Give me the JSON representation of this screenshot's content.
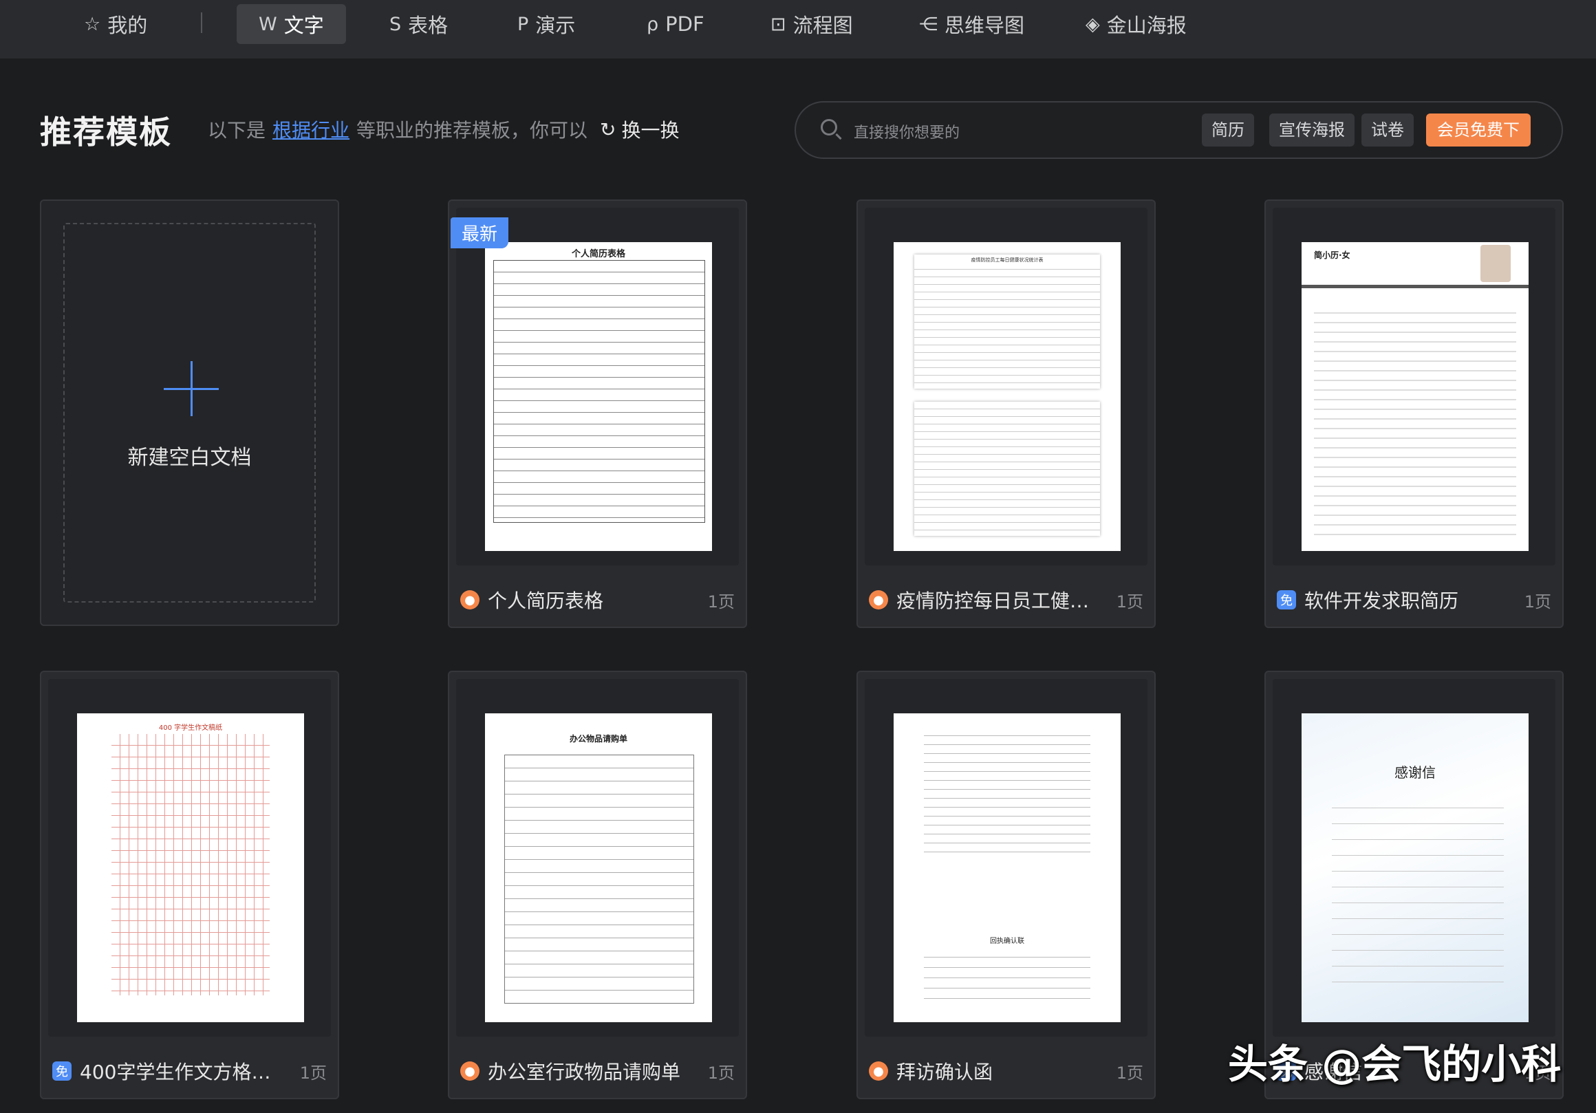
{
  "nav": {
    "tabs": [
      {
        "label": "我的",
        "icon": "star-icon"
      },
      {
        "label": "文字",
        "icon": "word-icon"
      },
      {
        "label": "表格",
        "icon": "sheet-icon"
      },
      {
        "label": "演示",
        "icon": "slides-icon"
      },
      {
        "label": "PDF",
        "icon": "pdf-icon"
      },
      {
        "label": "流程图",
        "icon": "flowchart-icon"
      },
      {
        "label": "思维导图",
        "icon": "mindmap-icon"
      },
      {
        "label": "金山海报",
        "icon": "poster-icon"
      }
    ]
  },
  "header": {
    "title": "推荐模板",
    "sub_prefix": "以下是",
    "sub_link": "根据行业",
    "sub_suffix": "等职业的推荐模板，你可以",
    "refresh_label": "换一换"
  },
  "search": {
    "placeholder": "直接搜你想要的",
    "chips": [
      "简历",
      "宣传海报",
      "试卷"
    ],
    "vip_label": "会员免费下"
  },
  "new_doc": {
    "label": "新建空白文档"
  },
  "templates": [
    {
      "title": "个人简历表格",
      "pages": "1页",
      "badge": "fire",
      "tag": "最新",
      "preview_title": "个人简历表格"
    },
    {
      "title": "疫情防控每日员工健…",
      "pages": "1页",
      "badge": "fire",
      "preview_title": "疫情防控员工每日健康状况统计表"
    },
    {
      "title": "软件开发求职简历",
      "pages": "1页",
      "badge": "free",
      "preview_title": "简小历·女"
    },
    {
      "title": "400字学生作文方格…",
      "pages": "1页",
      "badge": "free",
      "preview_title": "400 字学生作文稿纸"
    },
    {
      "title": "办公室行政物品请购单",
      "pages": "1页",
      "badge": "fire",
      "preview_title": "办公物品请购单"
    },
    {
      "title": "拜访确认函",
      "pages": "1页",
      "badge": "fire",
      "preview_title": "回执确认联"
    },
    {
      "title": "感谢信",
      "pages": "1页",
      "badge": "free",
      "preview_title": "感谢信"
    }
  ],
  "badges": {
    "free": "免",
    "fire": "●"
  },
  "watermark": "头条 @会飞的小科",
  "colors": {
    "accent": "#4f8df5",
    "vip": "#f5864a",
    "background": "#1c1d1f"
  }
}
